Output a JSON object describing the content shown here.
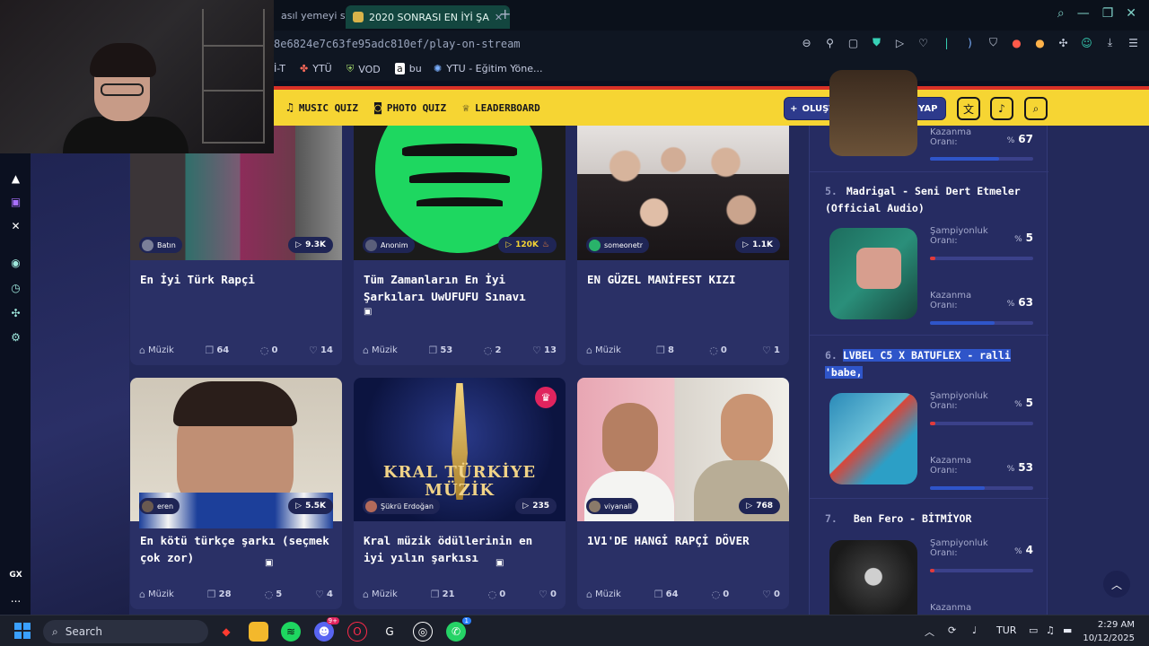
{
  "browser": {
    "tabs": [
      {
        "title": "asıl yemeyi sev",
        "active": false
      },
      {
        "title": "2020 SONRASI EN İYİ ŞA",
        "active": true
      }
    ],
    "url": "8e6824e7c63fe95adc810ef/play-on-stream",
    "bookmarks": [
      {
        "label": "İ-T",
        "icon": "partial-icon"
      },
      {
        "label": "YTÜ",
        "icon": "colorful-icon"
      },
      {
        "label": "VOD",
        "icon": "shield-icon"
      },
      {
        "label": "bu",
        "icon": "amazon-icon"
      },
      {
        "label": "YTU - Eğitim Yöne...",
        "icon": "gear-icon"
      }
    ]
  },
  "site": {
    "nav": [
      {
        "label": "MUSIC QUIZ",
        "icon": "music-note-icon"
      },
      {
        "label": "PHOTO QUIZ",
        "icon": "camera-icon"
      },
      {
        "label": "LEADERBOARD",
        "icon": "trophy-icon"
      }
    ],
    "create_label": "OLUŞTUR",
    "login_label": "GİRİŞ YAP"
  },
  "rail_labels": {
    "gx": "GX",
    "more": "..."
  },
  "cards": [
    {
      "author": "Batın",
      "plays": "9.3K",
      "title": "En İyi Türk Rapçi",
      "category": "Müzik",
      "questions": "64",
      "comments": "0",
      "likes": "14",
      "hot": false
    },
    {
      "author": "Anonim",
      "plays": "120K",
      "title": "Tüm Zamanların En İyi Şarkıları UwUFUFU Sınavı",
      "category": "Müzik",
      "questions": "53",
      "comments": "2",
      "likes": "13",
      "hot": true
    },
    {
      "author": "someonetr",
      "plays": "1.1K",
      "title": "EN GÜZEL MANİFEST KIZI",
      "category": "Müzik",
      "questions": "8",
      "comments": "0",
      "likes": "1",
      "hot": false
    },
    {
      "author": "eren",
      "plays": "5.5K",
      "title": "En kötü türkçe şarkı (seçmek çok zor)",
      "category": "Müzik",
      "questions": "28",
      "comments": "5",
      "likes": "4",
      "hot": false
    },
    {
      "author": "Şükrü Erdoğan",
      "plays": "235",
      "title": "Kral müzik ödüllerinin en iyi yılın şarkısı",
      "category": "Müzik",
      "questions": "21",
      "comments": "0",
      "likes": "0",
      "hot": false,
      "thumb_text": "KRAL TÜRKİYE MÜZİK"
    },
    {
      "author": "viyanali",
      "plays": "768",
      "title": "1V1'DE HANGİ RAPÇİ DÖVER",
      "category": "Müzik",
      "questions": "64",
      "comments": "0",
      "likes": "0",
      "hot": false
    }
  ],
  "leaderboard": {
    "win_label": "Kazanma",
    "champ_label": "Şampiyonluk",
    "rate_label": "Oranı:",
    "pct_sign": "%",
    "items": [
      {
        "rank": "",
        "title": "",
        "champ_pct": null,
        "win_pct": 67,
        "champ_bar": 0,
        "win_bar": 67
      },
      {
        "rank": "5.",
        "title": "Madrigal - Seni Dert Etmeler (Official Audio)",
        "champ_pct": 5,
        "win_pct": 63,
        "champ_bar": 5,
        "win_bar": 63
      },
      {
        "rank": "6.",
        "title": "LVBEL C5 X BATUFLEX - ralli 'babe,",
        "champ_pct": 5,
        "win_pct": 53,
        "champ_bar": 5,
        "win_bar": 53
      },
      {
        "rank": "7.",
        "title": "Ben Fero - BİTMİYOR",
        "champ_pct": 4,
        "win_pct": null,
        "champ_bar": 4,
        "win_bar": 0
      }
    ]
  },
  "taskbar": {
    "search_label": "Search",
    "language": "TUR",
    "time": "2:29 AM",
    "date": "10/12/2025",
    "discord_badge": "9+",
    "whatsapp_badge": "1"
  },
  "colors": {
    "header_yellow": "#f6d533",
    "header_red": "#d93127",
    "page_bg": "#23295a",
    "card_bg": "#2a3066",
    "bar_blue": "#2f55c9",
    "bar_red": "#e23a3a",
    "spotify_green": "#1ed760"
  }
}
